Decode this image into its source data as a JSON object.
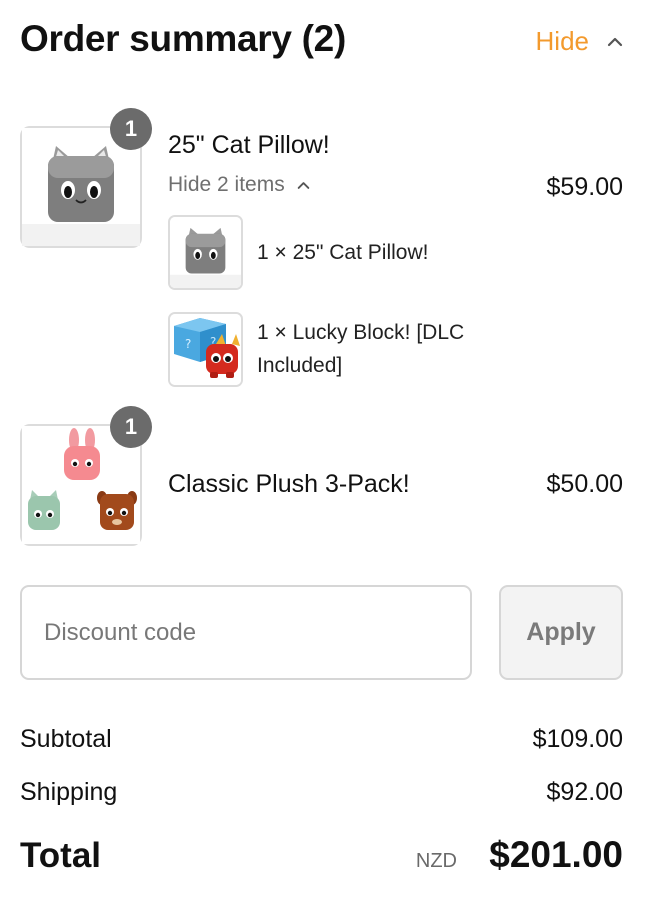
{
  "header": {
    "title": "Order summary (2)",
    "hide_label": "Hide",
    "accent_color": "#f39a2d"
  },
  "items": [
    {
      "name": "25\" Cat Pillow!",
      "price": "$59.00",
      "quantity": "1",
      "image_icon": "cat-pillow-image",
      "toggle_label": "Hide 2 items",
      "sub_items": [
        {
          "text": "1 × 25\" Cat Pillow!",
          "image_icon": "cat-pillow-image"
        },
        {
          "text": "1 × Lucky Block! [DLC Included]",
          "image_icon": "lucky-block-image"
        }
      ]
    },
    {
      "name": "Classic Plush 3-Pack!",
      "price": "$50.00",
      "quantity": "1",
      "image_icon": "plush-3-pack-image"
    }
  ],
  "discount": {
    "placeholder": "Discount code",
    "value": "",
    "apply_label": "Apply"
  },
  "totals": {
    "subtotal_label": "Subtotal",
    "subtotal_value": "$109.00",
    "shipping_label": "Shipping",
    "shipping_value": "$92.00",
    "total_label": "Total",
    "currency": "NZD",
    "total_value": "$201.00"
  }
}
